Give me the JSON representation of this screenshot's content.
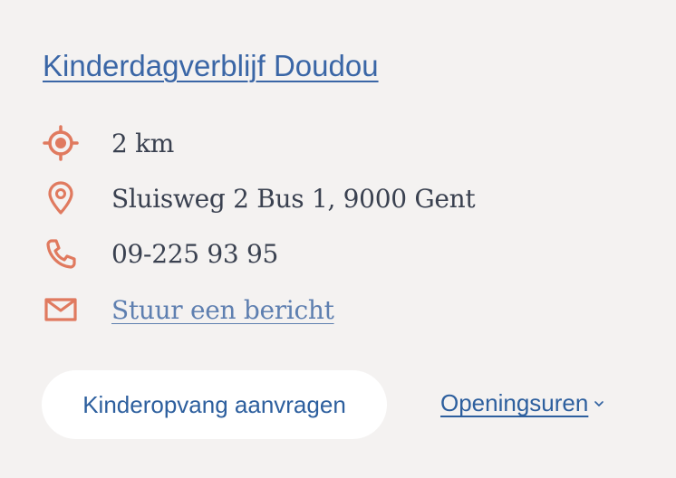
{
  "card": {
    "title": "Kinderdagverblijf Doudou",
    "details": {
      "distance": {
        "icon": "target-icon",
        "text": "2 km"
      },
      "address": {
        "icon": "location-pin-icon",
        "text": "Sluisweg 2 Bus 1, 9000 Gent"
      },
      "phone": {
        "icon": "phone-icon",
        "text": "09-225 93 95"
      },
      "message": {
        "icon": "envelope-icon",
        "text": "Stuur een bericht"
      }
    },
    "actions": {
      "request_label": "Kinderopvang aanvragen",
      "hours_label": "Openingsuren",
      "hours_icon": "chevron-down-icon"
    }
  },
  "colors": {
    "background": "#f4f2f1",
    "icon_accent": "#e07a5f",
    "link_blue": "#3a66a6",
    "text_dark": "#3a4150",
    "button_bg": "#ffffff"
  }
}
